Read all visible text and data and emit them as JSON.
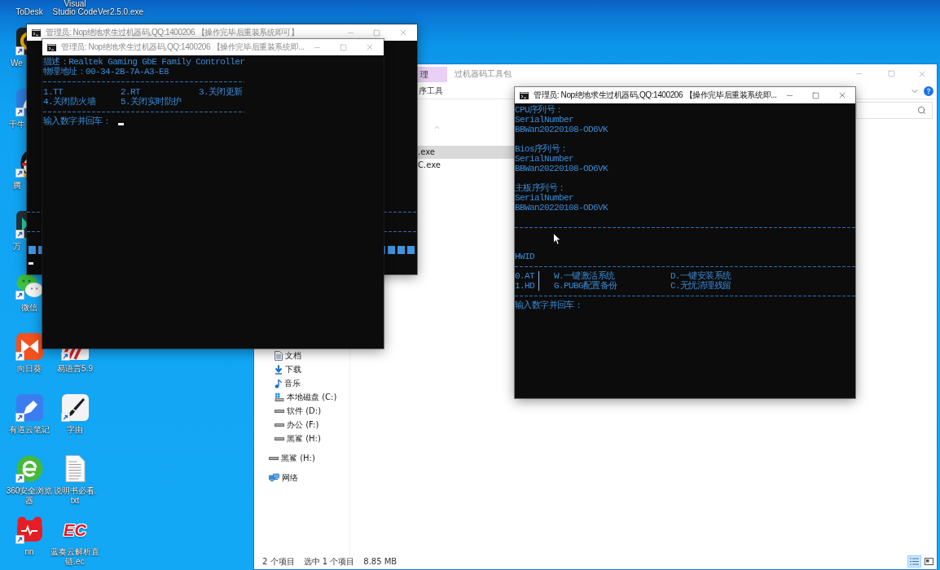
{
  "desktop": {
    "top_labels": [
      {
        "lines": [
          "ToDesk"
        ]
      },
      {
        "lines": [
          "Visual",
          "Studio Code"
        ]
      },
      {
        "lines": [
          "Ver2.5.0.exe"
        ]
      }
    ],
    "icon_columns": [
      {
        "icons": [
          {
            "kind": "ring",
            "label": [
              "We"
            ],
            "partly_hidden": true
          },
          {
            "kind": "tile",
            "label": [
              "千牛"
            ],
            "partly_hidden": true
          },
          {
            "kind": "penguin",
            "label": [
              "腾"
            ],
            "partly_hidden": true
          },
          {
            "kind": "split",
            "label": [
              "万"
            ],
            "partly_hidden": true
          },
          {
            "kind": "chat",
            "label": [
              "微信"
            ],
            "partly_hidden": false
          },
          {
            "kind": "bowtie",
            "label": [
              "向日葵"
            ],
            "partly_hidden": false
          },
          {
            "kind": "pen",
            "label": [
              "有道云笔记"
            ],
            "partly_hidden": false
          },
          {
            "kind": "browser",
            "label": [
              "360安全浏览",
              "器"
            ],
            "partly_hidden": false
          },
          {
            "kind": "pulse",
            "label": [
              "nn"
            ],
            "partly_hidden": false
          }
        ]
      },
      {
        "icons": [
          {
            "kind": "stripes",
            "label": [
              "易语言5.9"
            ],
            "partly_hidden": true
          },
          {
            "kind": "brush",
            "label": [
              "字由"
            ],
            "partly_hidden": false
          },
          {
            "kind": "document",
            "label": [
              "说明书必看.",
              "txt"
            ],
            "partly_hidden": false
          },
          {
            "kind": "lettermark",
            "mark_text": "EC",
            "label": [
              "蓝奏云解析直",
              "链.ec"
            ],
            "partly_hidden": false
          }
        ]
      }
    ]
  },
  "back_console": {
    "title": "管理员: Nop绝地求生过机器码,QQ:1400206 【操作完毕后重装系统即可】",
    "active": false
  },
  "network_console": {
    "title": "管理员: Nop绝地求生过机器码,QQ:1400206 【操作完毕后重装系统即...",
    "active": false,
    "info_lines": [
      "描述：Realtek Gaming GbE Family Controller",
      "物理地址：00-34-2B-7A-A3-E8"
    ],
    "menu_rows": [
      {
        "options": [
          "1.TT",
          "2.RT",
          "3.关闭更新"
        ]
      },
      {
        "options": [
          "4.关闭防火墙",
          "5.关闭实时防护"
        ]
      }
    ],
    "prompt": "输入数字并回车："
  },
  "explorer": {
    "active": false,
    "context_tab": "理",
    "title": "过机器码工具包",
    "ribbon_tab": "序工具",
    "nav_pane": [
      {
        "children": [
          {
            "kind": "documents",
            "label": "文档"
          },
          {
            "kind": "downloads",
            "label": "下载"
          },
          {
            "kind": "music",
            "label": "音乐"
          },
          {
            "kind": "system-drive",
            "label": "本地磁盘 (C:)"
          },
          {
            "kind": "drive",
            "label": "软件 (D:)"
          },
          {
            "kind": "drive",
            "label": "办公 (F:)"
          },
          {
            "kind": "drive",
            "label": "黑鲨 (H:)"
          }
        ]
      },
      {
        "kind": "drive",
        "label": "黑鲨 (H:)"
      },
      {
        "kind": "network",
        "label": "网络"
      }
    ],
    "files": [
      {
        "name": ".exe",
        "selected": true
      },
      {
        "name": "C.exe",
        "selected": false
      }
    ],
    "status_bar": {
      "texts": [
        "2 个项目",
        "选中 1 个项目",
        "8.85 MB"
      ],
      "views": [
        {
          "kind": "details",
          "selected": true
        },
        {
          "kind": "large-icons",
          "selected": false
        }
      ]
    }
  },
  "serial_console": {
    "title": "管理员: Nop绝地求生过机器码,QQ:1400206 【操作完毕后重装系统即...",
    "active": true,
    "serial_sections": [
      {
        "heading": "CPU序列号：",
        "lines": [
          "SerialNumber",
          "BBWan20220108-OD6VK"
        ]
      },
      {
        "heading": "Bios序列号：",
        "lines": [
          "SerialNumber",
          "BBWan20220108-OD6VK"
        ]
      },
      {
        "heading": "主板序列号：",
        "lines": [
          "SerialNumber",
          "BBWan20220108-OD6VK"
        ]
      }
    ],
    "hwid_label": "HWID",
    "menu_rows": [
      {
        "option": "0.AT",
        "actions": [
          "W.一键激活系统",
          "D.一键安装系统"
        ]
      },
      {
        "option": "1.HD",
        "actions": [
          "G.PUBG配置备份",
          "C.无忧清理残留"
        ]
      }
    ],
    "prompt": "输入数字并回车："
  }
}
